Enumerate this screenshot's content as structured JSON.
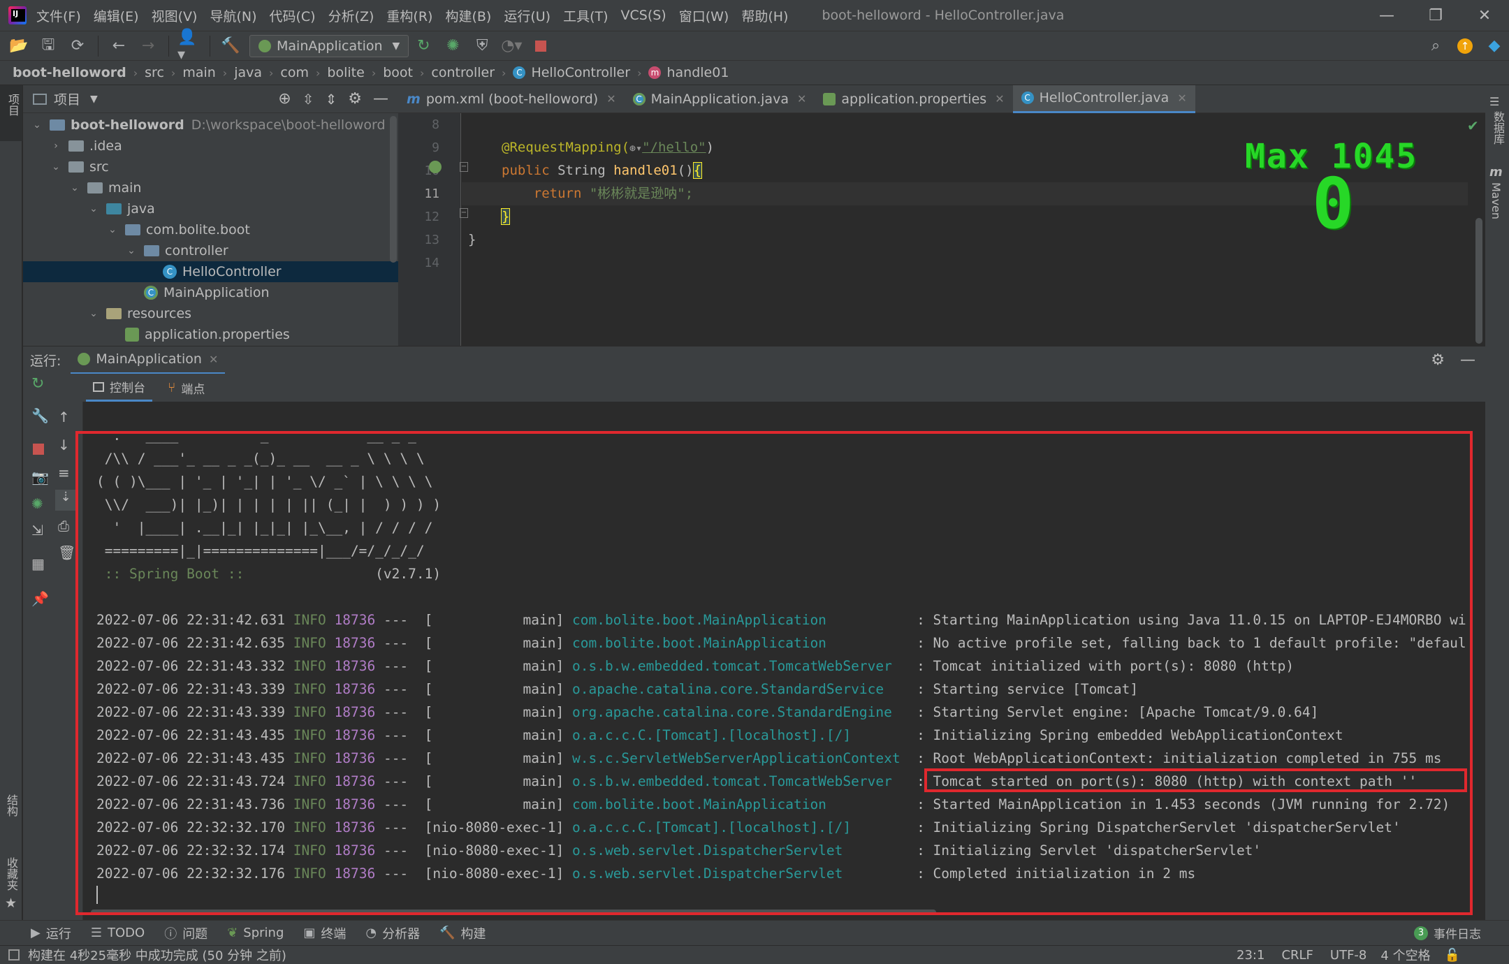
{
  "window": {
    "title": "boot-helloword - HelloController.java",
    "menu": [
      "文件(F)",
      "编辑(E)",
      "视图(V)",
      "导航(N)",
      "代码(C)",
      "分析(Z)",
      "重构(R)",
      "构建(B)",
      "运行(U)",
      "工具(T)",
      "VCS(S)",
      "窗口(W)",
      "帮助(H)"
    ]
  },
  "toolbar": {
    "run_config": "MainApplication",
    "icons": [
      "folder-open-icon",
      "save-icon",
      "sync-icon",
      "back-icon",
      "forward-icon",
      "user-icon",
      "hammer-icon",
      "run-icon",
      "debug-icon",
      "coverage-icon",
      "profile-icon",
      "stop-icon",
      "search-icon",
      "update-icon",
      "plugin-icon"
    ]
  },
  "breadcrumb": [
    "boot-helloword",
    "src",
    "main",
    "java",
    "com",
    "bolite",
    "boot",
    "controller",
    "HelloController",
    "handle01"
  ],
  "sidebar_left": {
    "project_label": "项目",
    "structure_label": "结构",
    "favorites_label": "收藏夹"
  },
  "sidebar_right": {
    "database_label": "数据库",
    "maven_label": "Maven"
  },
  "project": {
    "header_label": "项目",
    "tree": [
      {
        "label": "boot-helloword",
        "path": "D:\\workspace\\boot-helloword",
        "depth": 0,
        "kind": "module",
        "expanded": true
      },
      {
        "label": ".idea",
        "depth": 1,
        "kind": "folder",
        "expanded": false
      },
      {
        "label": "src",
        "depth": 1,
        "kind": "folder",
        "expanded": true
      },
      {
        "label": "main",
        "depth": 2,
        "kind": "folder",
        "expanded": true
      },
      {
        "label": "java",
        "depth": 3,
        "kind": "source",
        "expanded": true
      },
      {
        "label": "com.bolite.boot",
        "depth": 4,
        "kind": "package",
        "expanded": true
      },
      {
        "label": "controller",
        "depth": 5,
        "kind": "package",
        "expanded": true
      },
      {
        "label": "HelloController",
        "depth": 6,
        "kind": "class",
        "selected": true
      },
      {
        "label": "MainApplication",
        "depth": 5,
        "kind": "spring"
      },
      {
        "label": "resources",
        "depth": 3,
        "kind": "resources",
        "expanded": true
      },
      {
        "label": "application.properties",
        "depth": 4,
        "kind": "properties"
      }
    ]
  },
  "editor": {
    "tabs": [
      {
        "label": "pom.xml (boot-helloword)",
        "icon": "maven-icon",
        "active": false
      },
      {
        "label": "MainApplication.java",
        "icon": "spring-class-icon",
        "active": false
      },
      {
        "label": "application.properties",
        "icon": "properties-icon",
        "active": false
      },
      {
        "label": "HelloController.java",
        "icon": "class-icon",
        "active": true
      }
    ],
    "line_numbers": [
      "8",
      "9",
      "10",
      "11",
      "12",
      "13",
      "14"
    ],
    "code": {
      "l9_annotation": "@RequestMapping(",
      "l9_path": "\"/hello\"",
      "l9_close": ")",
      "l10_public": "public",
      "l10_type": " String ",
      "l10_method": "handle01",
      "l10_parens": "()",
      "l10_brace": "{",
      "l11_return": "return",
      "l11_string": "\"彬彬就是逊呐\";",
      "l12_brace": "}",
      "l13_brace": "}"
    },
    "overlay_max": "Max 1045",
    "overlay_count": "0"
  },
  "run": {
    "label": "运行:",
    "tab": "MainApplication",
    "console_tab": "控制台",
    "endpoints_tab": "端点",
    "banner": [
      "  .   ____          _            __ _ _",
      " /\\\\ / ___'_ __ _ _(_)_ __  __ _ \\ \\ \\ \\",
      "( ( )\\___ | '_ | '_| | '_ \\/ _` | \\ \\ \\ \\",
      " \\\\/  ___)| |_)| | | | | || (_| |  ) ) ) )",
      "  '  |____| .__|_| |_|_| |_\\__, | / / / /",
      " =========|_|==============|___/=/_/_/_/"
    ],
    "spring_label": " :: Spring Boot :: ",
    "spring_version": "               (v2.7.1)",
    "logs": [
      {
        "ts": "2022-07-06 22:31:42.631",
        "level": "INFO",
        "pid": "18736",
        "thread": "---  [           main]",
        "logger": "com.bolite.boot.MainApplication         ",
        "msg": ": Starting MainApplication using Java 11.0.15 on LAPTOP-EJ4MORBO wi"
      },
      {
        "ts": "2022-07-06 22:31:42.635",
        "level": "INFO",
        "pid": "18736",
        "thread": "---  [           main]",
        "logger": "com.bolite.boot.MainApplication         ",
        "msg": ": No active profile set, falling back to 1 default profile: \"defaul"
      },
      {
        "ts": "2022-07-06 22:31:43.332",
        "level": "INFO",
        "pid": "18736",
        "thread": "---  [           main]",
        "logger": "o.s.b.w.embedded.tomcat.TomcatWebServer ",
        "msg": ": Tomcat initialized with port(s): 8080 (http)"
      },
      {
        "ts": "2022-07-06 22:31:43.339",
        "level": "INFO",
        "pid": "18736",
        "thread": "---  [           main]",
        "logger": "o.apache.catalina.core.StandardService  ",
        "msg": ": Starting service [Tomcat]"
      },
      {
        "ts": "2022-07-06 22:31:43.339",
        "level": "INFO",
        "pid": "18736",
        "thread": "---  [           main]",
        "logger": "org.apache.catalina.core.StandardEngine ",
        "msg": ": Starting Servlet engine: [Apache Tomcat/9.0.64]"
      },
      {
        "ts": "2022-07-06 22:31:43.435",
        "level": "INFO",
        "pid": "18736",
        "thread": "---  [           main]",
        "logger": "o.a.c.c.C.[Tomcat].[localhost].[/]      ",
        "msg": ": Initializing Spring embedded WebApplicationContext"
      },
      {
        "ts": "2022-07-06 22:31:43.435",
        "level": "INFO",
        "pid": "18736",
        "thread": "---  [           main]",
        "logger": "w.s.c.ServletWebServerApplicationContext",
        "msg": ": Root WebApplicationContext: initialization completed in 755 ms"
      },
      {
        "ts": "2022-07-06 22:31:43.724",
        "level": "INFO",
        "pid": "18736",
        "thread": "---  [           main]",
        "logger": "o.s.b.w.embedded.tomcat.TomcatWebServer ",
        "msg": ": Tomcat started on port(s): 8080 (http) with context path ''"
      },
      {
        "ts": "2022-07-06 22:31:43.736",
        "level": "INFO",
        "pid": "18736",
        "thread": "---  [           main]",
        "logger": "com.bolite.boot.MainApplication         ",
        "msg": ": Started MainApplication in 1.453 seconds (JVM running for 2.72)"
      },
      {
        "ts": "2022-07-06 22:32:32.170",
        "level": "INFO",
        "pid": "18736",
        "thread": "---  [nio-8080-exec-1]",
        "logger": "o.a.c.c.C.[Tomcat].[localhost].[/]      ",
        "msg": ": Initializing Spring DispatcherServlet 'dispatcherServlet'"
      },
      {
        "ts": "2022-07-06 22:32:32.174",
        "level": "INFO",
        "pid": "18736",
        "thread": "---  [nio-8080-exec-1]",
        "logger": "o.s.web.servlet.DispatcherServlet       ",
        "msg": ": Initializing Servlet 'dispatcherServlet'"
      },
      {
        "ts": "2022-07-06 22:32:32.176",
        "level": "INFO",
        "pid": "18736",
        "thread": "---  [nio-8080-exec-1]",
        "logger": "o.s.web.servlet.DispatcherServlet       ",
        "msg": ": Completed initialization in 2 ms"
      }
    ]
  },
  "bottom_tools": [
    {
      "label": "运行",
      "icon": "run-icon"
    },
    {
      "label": "TODO",
      "icon": "todo-icon"
    },
    {
      "label": "问题",
      "icon": "problems-icon"
    },
    {
      "label": "Spring",
      "icon": "spring-icon"
    },
    {
      "label": "终端",
      "icon": "terminal-icon"
    },
    {
      "label": "分析器",
      "icon": "profiler-icon"
    },
    {
      "label": "构建",
      "icon": "build-icon"
    }
  ],
  "event_log": {
    "count": "3",
    "label": "事件日志"
  },
  "status": {
    "message": "构建在 4秒25毫秒 中成功完成 (50 分钟 之前)",
    "position": "23:1",
    "line_sep": "CRLF",
    "encoding": "UTF-8",
    "indent": "4 个空格"
  },
  "colors": {
    "annotation": "#bbb529",
    "keyword": "#cc7832",
    "string": "#6a8759",
    "logger": "#299999",
    "highlight_box": "#e0282e",
    "overlay_green": "#27d827"
  }
}
